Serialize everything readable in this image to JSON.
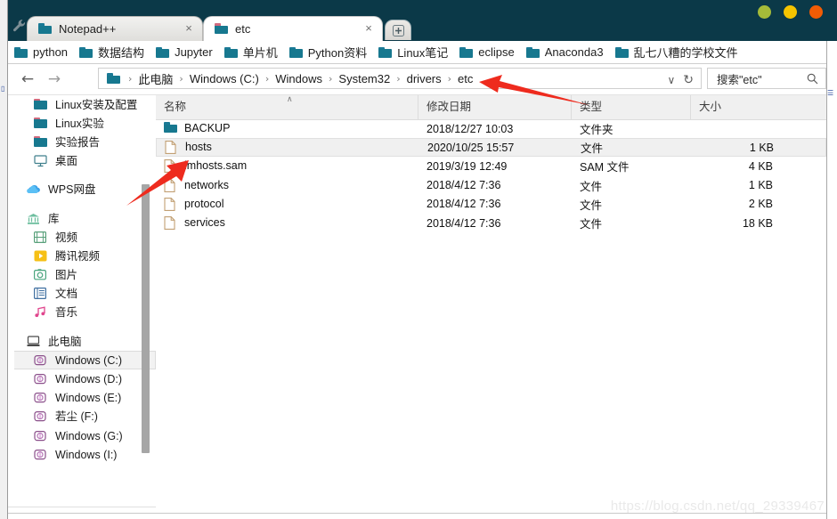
{
  "window": {
    "titlebar_color": "#0b3948",
    "controls": [
      {
        "name": "minimize",
        "color": "#a5bb39"
      },
      {
        "name": "maximize",
        "color": "#f5c400"
      },
      {
        "name": "close",
        "color": "#f25c05"
      }
    ]
  },
  "tabs": {
    "items": [
      {
        "label": "Notepad++",
        "active": false,
        "icon": "folder-icon",
        "close_label": "×"
      },
      {
        "label": "etc",
        "active": true,
        "icon": "folder-icon",
        "close_label": "×"
      }
    ],
    "new_tab_label": "⊞"
  },
  "bookmarks": {
    "items": [
      {
        "label": "python"
      },
      {
        "label": "数据结构"
      },
      {
        "label": "Jupyter"
      },
      {
        "label": "单片机"
      },
      {
        "label": "Python资料"
      },
      {
        "label": "Linux笔记"
      },
      {
        "label": "eclipse"
      },
      {
        "label": "Anaconda3"
      },
      {
        "label": "乱七八糟的学校文件"
      }
    ]
  },
  "addressbar": {
    "back_label": "←",
    "forward_label": "→",
    "breadcrumbs": [
      "此电脑",
      "Windows (C:)",
      "Windows",
      "System32",
      "drivers",
      "etc"
    ],
    "separator": "›",
    "dropdown_label": "∨",
    "refresh_label": "↻",
    "search_placeholder": "搜索\"etc\"",
    "search_icon_label": "⚲"
  },
  "nav_pane": {
    "items": [
      {
        "label": "Linux安装及配置",
        "icon": "folder-icon",
        "indent": 2,
        "selected": false,
        "gap_before": false
      },
      {
        "label": "Linux实验",
        "icon": "folder-icon",
        "indent": 2,
        "selected": false,
        "gap_before": false
      },
      {
        "label": "实验报告",
        "icon": "folder-icon",
        "indent": 2,
        "selected": false,
        "gap_before": false
      },
      {
        "label": "桌面",
        "icon": "desktop-icon",
        "indent": 2,
        "selected": false,
        "gap_before": false
      },
      {
        "label": "WPS网盘",
        "icon": "cloud-icon",
        "indent": 1,
        "selected": false,
        "gap_before": true
      },
      {
        "label": "库",
        "icon": "library-icon",
        "indent": 1,
        "selected": false,
        "gap_before": true
      },
      {
        "label": "视频",
        "icon": "video-icon",
        "indent": 2,
        "selected": false,
        "gap_before": false
      },
      {
        "label": "腾讯视频",
        "icon": "tencent-video-icon",
        "indent": 2,
        "selected": false,
        "gap_before": false
      },
      {
        "label": "图片",
        "icon": "pictures-icon",
        "indent": 2,
        "selected": false,
        "gap_before": false
      },
      {
        "label": "文档",
        "icon": "documents-icon",
        "indent": 2,
        "selected": false,
        "gap_before": false
      },
      {
        "label": "音乐",
        "icon": "music-icon",
        "indent": 2,
        "selected": false,
        "gap_before": false
      },
      {
        "label": "此电脑",
        "icon": "computer-icon",
        "indent": 1,
        "selected": false,
        "gap_before": true
      },
      {
        "label": "Windows (C:)",
        "icon": "drive-icon",
        "indent": 2,
        "selected": true,
        "gap_before": false
      },
      {
        "label": "Windows (D:)",
        "icon": "drive-icon",
        "indent": 2,
        "selected": false,
        "gap_before": false
      },
      {
        "label": "Windows (E:)",
        "icon": "drive-icon",
        "indent": 2,
        "selected": false,
        "gap_before": false
      },
      {
        "label": "若尘 (F:)",
        "icon": "drive-icon",
        "indent": 2,
        "selected": false,
        "gap_before": false
      },
      {
        "label": "Windows (G:)",
        "icon": "drive-icon",
        "indent": 2,
        "selected": false,
        "gap_before": false
      },
      {
        "label": "Windows (I:)",
        "icon": "drive-icon",
        "indent": 2,
        "selected": false,
        "gap_before": false
      }
    ]
  },
  "file_list": {
    "columns": [
      {
        "label": "名称",
        "sorted": true,
        "sort_glyph": "∧"
      },
      {
        "label": "修改日期",
        "sorted": false,
        "sort_glyph": ""
      },
      {
        "label": "类型",
        "sorted": false,
        "sort_glyph": ""
      },
      {
        "label": "大小",
        "sorted": false,
        "sort_glyph": ""
      }
    ],
    "rows": [
      {
        "name": "BACKUP",
        "icon": "folder-icon",
        "date": "2018/12/27 10:03",
        "type": "文件夹",
        "size": "",
        "selected": false
      },
      {
        "name": "hosts",
        "icon": "file-icon",
        "date": "2020/10/25 15:57",
        "type": "文件",
        "size": "1 KB",
        "selected": true
      },
      {
        "name": "lmhosts.sam",
        "icon": "file-icon",
        "date": "2019/3/19 12:49",
        "type": "SAM 文件",
        "size": "4 KB",
        "selected": false
      },
      {
        "name": "networks",
        "icon": "file-icon",
        "date": "2018/4/12 7:36",
        "type": "文件",
        "size": "1 KB",
        "selected": false
      },
      {
        "name": "protocol",
        "icon": "file-icon",
        "date": "2018/4/12 7:36",
        "type": "文件",
        "size": "2 KB",
        "selected": false
      },
      {
        "name": "services",
        "icon": "file-icon",
        "date": "2018/4/12 7:36",
        "type": "文件",
        "size": "18 KB",
        "selected": false
      }
    ]
  },
  "annotations": {
    "arrow_color": "#ee2b1e",
    "arrows": [
      {
        "name": "arrow-to-etc-breadcrumb",
        "points_to": "etc"
      },
      {
        "name": "arrow-to-hosts-file",
        "points_to": "hosts"
      }
    ]
  },
  "watermark": {
    "text": "https://blog.csdn.net/qq_29339467"
  }
}
